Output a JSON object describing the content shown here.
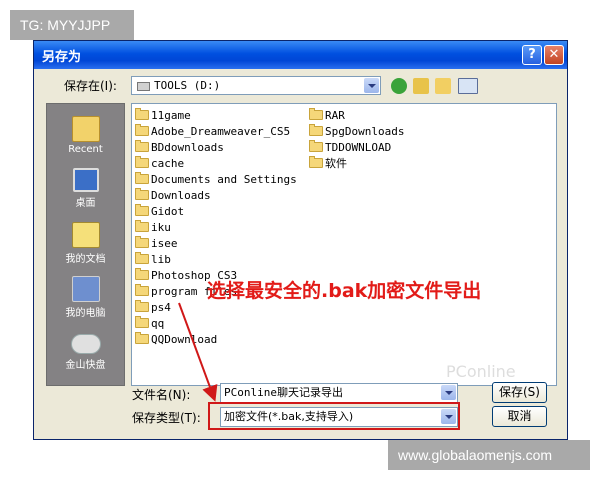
{
  "watermarks": {
    "top_left": "TG: MYYJJPP",
    "bottom_right": "www.globalaomenjs.com"
  },
  "dialog": {
    "title": "另存为",
    "help_label": "?",
    "close_label": "✕",
    "save_in_label": "保存在(I):",
    "save_in_value": "TOOLS (D:)",
    "toolbar_icons": [
      "back-icon",
      "up-folder-icon",
      "new-folder-icon",
      "view-menu-icon"
    ]
  },
  "places": [
    {
      "label": "Recent",
      "icon": "recent-icon"
    },
    {
      "label": "桌面",
      "icon": "desktop-icon"
    },
    {
      "label": "我的文档",
      "icon": "my-documents-icon"
    },
    {
      "label": "我的电脑",
      "icon": "my-computer-icon"
    },
    {
      "label": "金山快盘",
      "icon": "kuaipan-icon"
    }
  ],
  "files": {
    "col1": [
      "11game",
      "Adobe_Dreamweaver_CS5",
      "BDdownloads",
      "cache",
      "Documents and Settings",
      "Downloads",
      "Gidot",
      "iku",
      "isee",
      "lib",
      "Photoshop CS3",
      "program files",
      "ps4",
      "qq",
      "QQDownload"
    ],
    "col2": [
      "RAR",
      "SpgDownloads",
      "TDDOWNLOAD",
      "软件"
    ]
  },
  "filename": {
    "label": "文件名(N):",
    "value": "PConline聊天记录导出"
  },
  "filetype": {
    "label": "保存类型(T):",
    "value": "加密文件(*.bak,支持导入)"
  },
  "buttons": {
    "save": "保存(S)",
    "cancel": "取消"
  },
  "annotation": "选择最安全的.bak加密文件导出",
  "ghost_watermark": "PConline"
}
